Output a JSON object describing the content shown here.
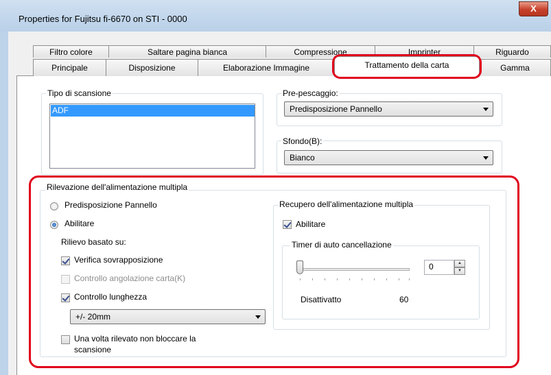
{
  "window": {
    "title": "Properties for Fujitsu fi-6670 on STI - 0000",
    "close_glyph": "X"
  },
  "tabs": {
    "row_back": [
      {
        "label": "Filtro colore"
      },
      {
        "label": "Saltare pagina bianca"
      },
      {
        "label": "Compressione"
      },
      {
        "label": "Imprinter"
      },
      {
        "label": "Riguardo"
      }
    ],
    "row_front": [
      {
        "label": "Principale"
      },
      {
        "label": "Disposizione"
      },
      {
        "label": "Elaborazione Immagine"
      },
      {
        "label": "Trattamento della carta",
        "active": true
      },
      {
        "label": "Gamma"
      }
    ]
  },
  "scan_type": {
    "label": "Tipo di scansione",
    "items": [
      "ADF"
    ],
    "selected": "ADF"
  },
  "prepick": {
    "label": "Pre-pescaggio:",
    "value": "Predisposizione Pannello"
  },
  "background": {
    "label": "Sfondo(B):",
    "value": "Bianco"
  },
  "multifeed": {
    "label": "Rilevazione dell'alimentazione multipla",
    "radio_panel": "Predisposizione Pannello",
    "radio_enable": "Abilitare",
    "selected": "Abilitare",
    "based_on_label": "Rilievo basato su:",
    "overlap": {
      "label": "Verifica sovrapposizione",
      "checked": true
    },
    "angle": {
      "label": "Controllo angolazione carta(K)",
      "checked": false,
      "disabled": true
    },
    "length": {
      "label": "Controllo lunghezza",
      "checked": true
    },
    "length_value": "+/- 20mm",
    "no_stop": {
      "label_line1": "Una volta rilevato non bloccare la",
      "label_line2": "scansione",
      "checked": false
    }
  },
  "recovery": {
    "label": "Recupero dell'alimentazione multipla",
    "enable": {
      "label": "Abilitare",
      "checked": true
    },
    "timer_label": "Timer di auto cancellazione",
    "slider_value": 0,
    "spin_value": "0",
    "min_label": "Disattivatto",
    "max_label": "60",
    "spin_up": "▲",
    "spin_down": "▼"
  },
  "colors": {
    "highlight": "#e0001b",
    "selection": "#3399ff"
  }
}
